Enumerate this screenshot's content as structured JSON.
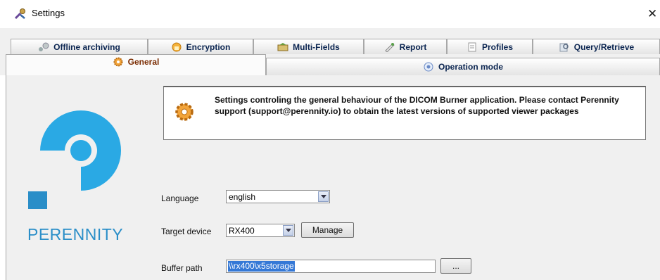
{
  "window": {
    "title": "Settings",
    "close_glyph": "✕",
    "icon": "settings-wrench-icon"
  },
  "tabs": {
    "row1": [
      {
        "label": "Offline archiving",
        "icon": "archive-icon"
      },
      {
        "label": "Encryption",
        "icon": "lock-icon"
      },
      {
        "label": "Multi-Fields",
        "icon": "fields-icon"
      },
      {
        "label": "Report",
        "icon": "report-icon"
      },
      {
        "label": "Profiles",
        "icon": "profiles-icon"
      },
      {
        "label": "Query/Retrieve",
        "icon": "query-icon"
      }
    ],
    "row2": [
      {
        "label": "General",
        "icon": "gear-icon",
        "selected": true
      },
      {
        "label": "Operation mode",
        "icon": "operation-icon",
        "selected": false
      }
    ]
  },
  "brand": {
    "name": "PERENNITY",
    "color": "#2a8ec8"
  },
  "info": {
    "text": "Settings controling the general behaviour of the DICOM Burner application. Please contact Perennity support (support@perennity.io) to obtain the latest versions of supported viewer packages"
  },
  "form": {
    "language": {
      "label": "Language",
      "value": "english"
    },
    "target_device": {
      "label": "Target device",
      "value": "RX400",
      "manage_label": "Manage"
    },
    "buffer_path": {
      "label": "Buffer path",
      "value": "\\\\rx400\\x5storage",
      "browse_label": "..."
    }
  }
}
